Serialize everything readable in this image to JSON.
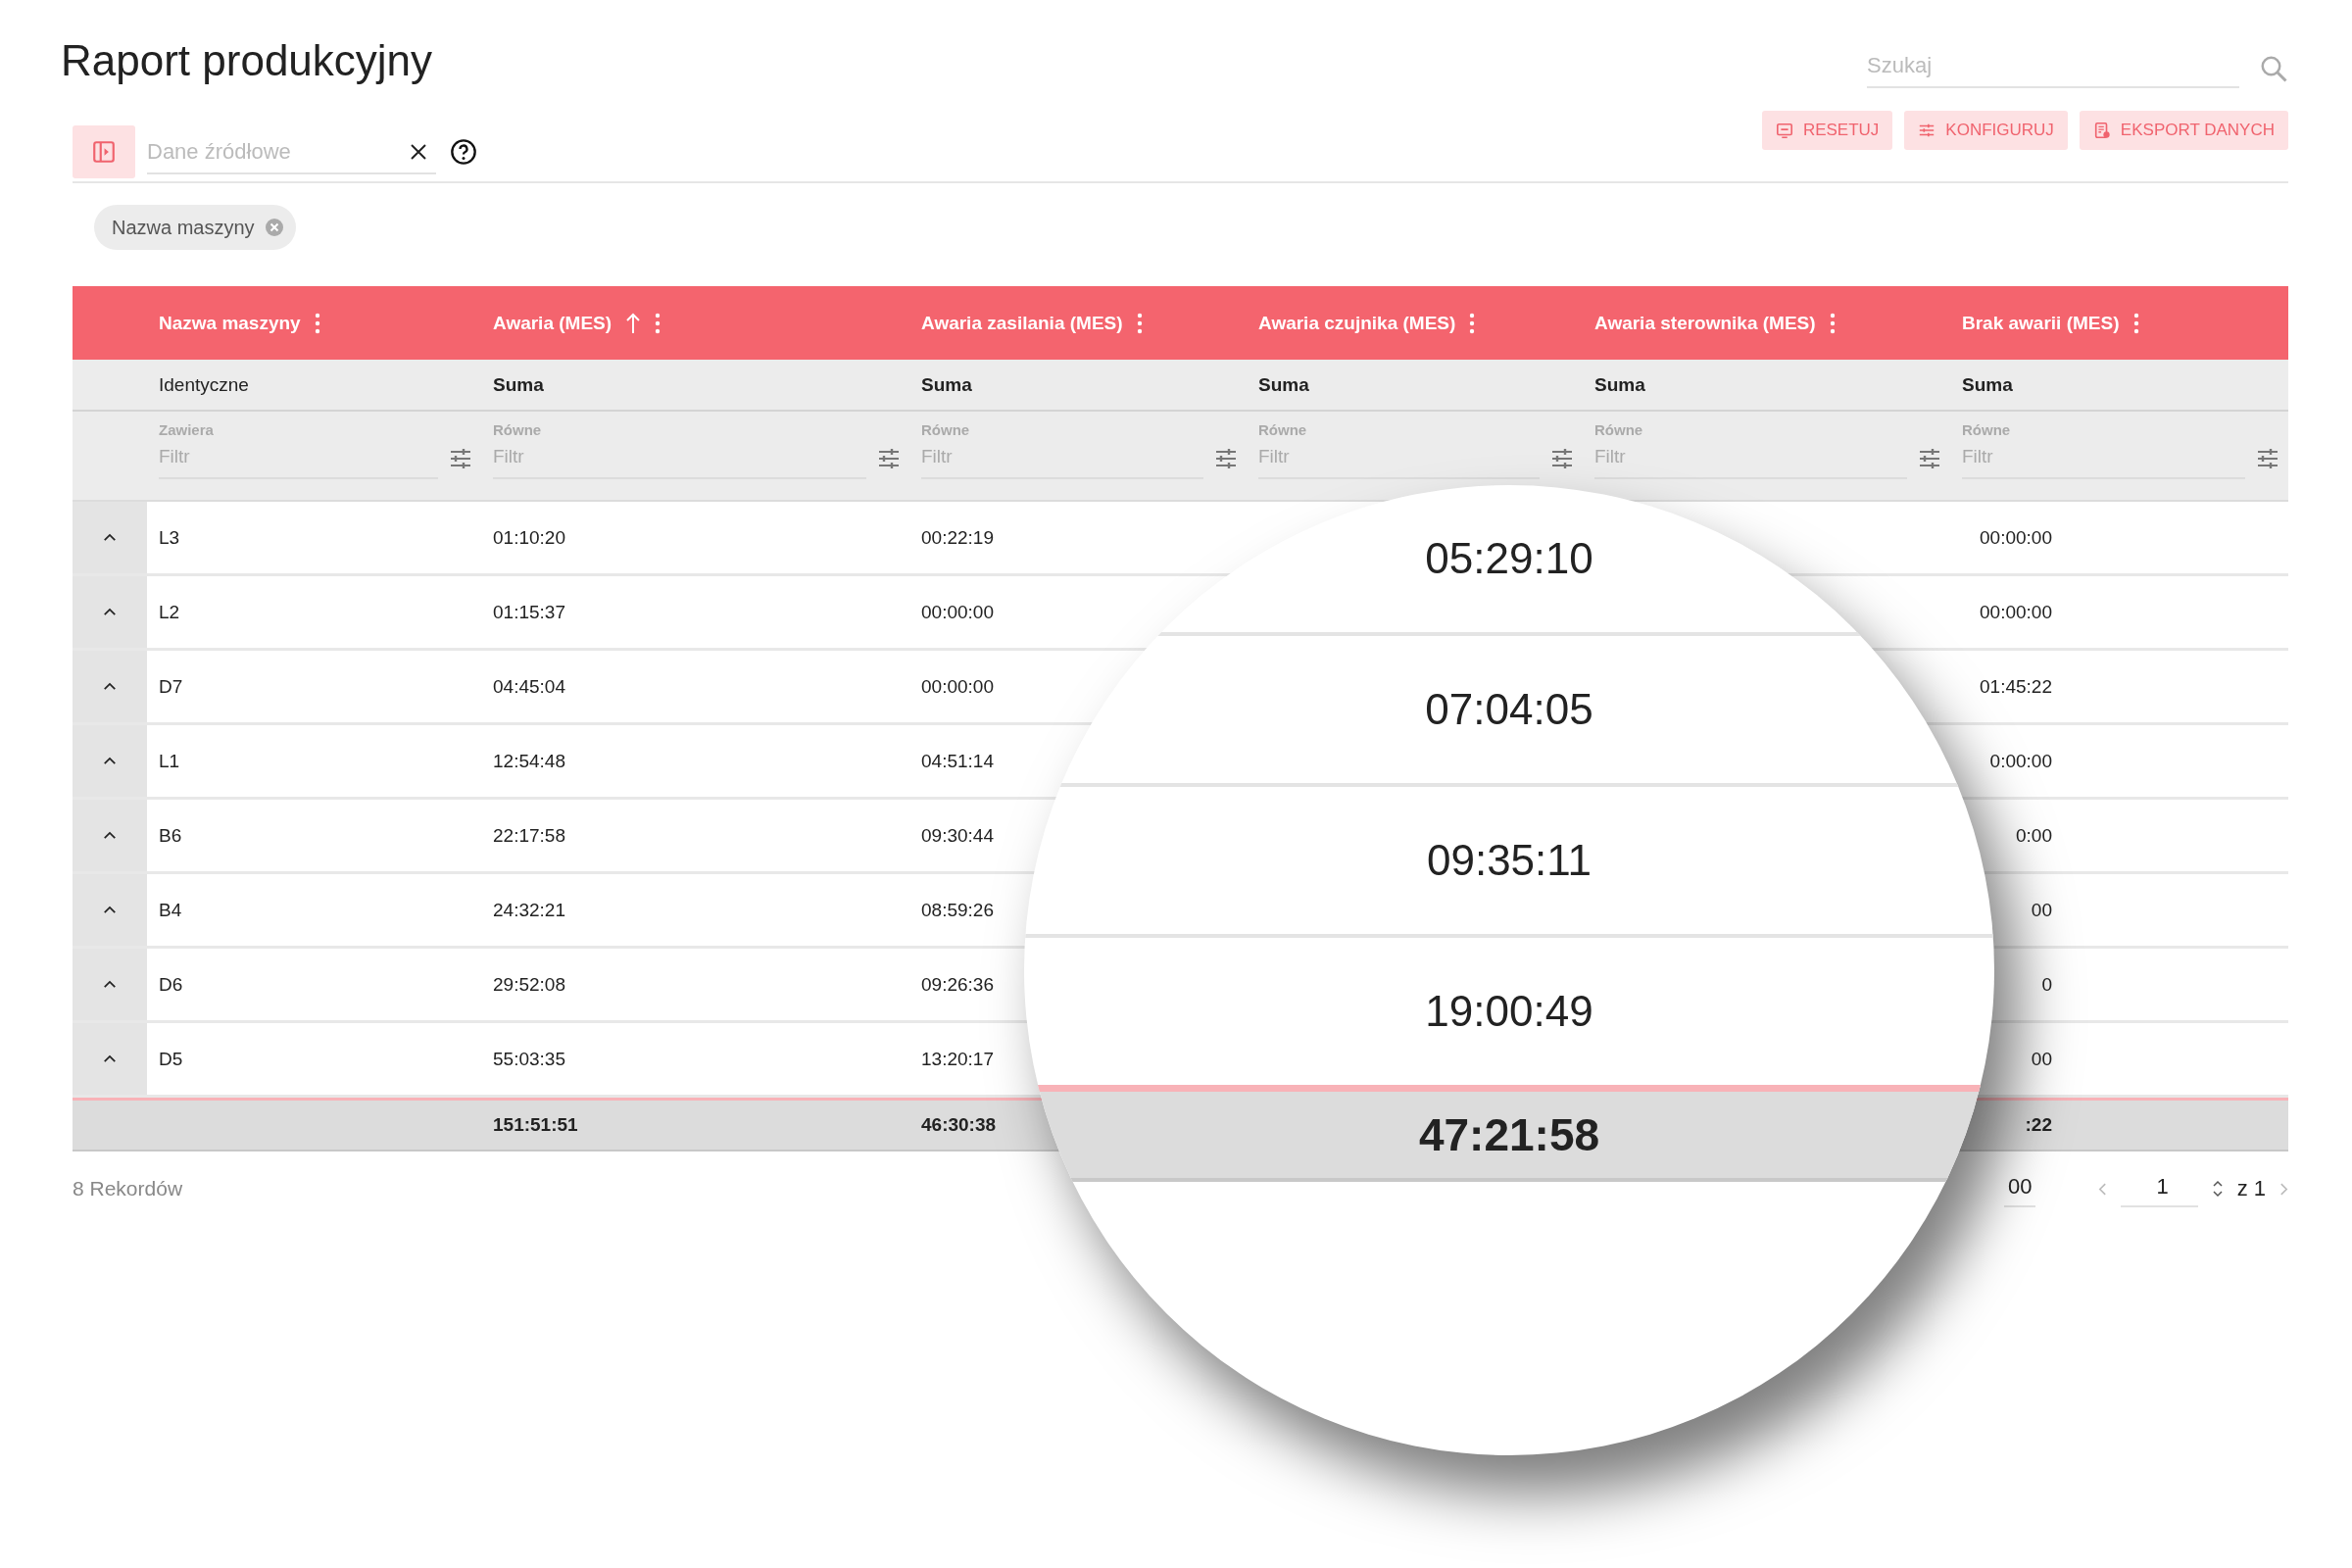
{
  "title": "Raport produkcyjny",
  "search": {
    "placeholder": "Szukaj"
  },
  "source_field": {
    "placeholder": "Dane źródłowe"
  },
  "toolbar_buttons": [
    {
      "kind": "reset",
      "label": "RESETUJ"
    },
    {
      "kind": "configure",
      "label": "KONFIGURUJ"
    },
    {
      "kind": "export",
      "label": "EKSPORT DANYCH"
    }
  ],
  "group_chips": [
    {
      "label": "Nazwa maszyny"
    }
  ],
  "table": {
    "columns": [
      {
        "kind": "text",
        "label": "Nazwa maszyny",
        "sorted": false,
        "aggregate": "Identyczne",
        "filter_label": "Zawiera",
        "filter_placeholder": "Filtr"
      },
      {
        "kind": "time",
        "label": "Awaria (MES)",
        "sorted": true,
        "aggregate": "Suma",
        "filter_label": "Równe",
        "filter_placeholder": "Filtr"
      },
      {
        "kind": "time",
        "label": "Awaria zasilania (MES)",
        "sorted": false,
        "aggregate": "Suma",
        "filter_label": "Równe",
        "filter_placeholder": "Filtr"
      },
      {
        "kind": "time",
        "label": "Awaria czujnika (MES)",
        "sorted": false,
        "aggregate": "Suma",
        "filter_label": "Równe",
        "filter_placeholder": "Filtr"
      },
      {
        "kind": "time",
        "label": "Awaria sterownika (MES)",
        "sorted": false,
        "aggregate": "Suma",
        "filter_label": "Równe",
        "filter_placeholder": "Filtr"
      },
      {
        "kind": "time",
        "label": "Brak awarii (MES)",
        "sorted": false,
        "aggregate": "Suma",
        "filter_label": "Równe",
        "filter_placeholder": "Filtr"
      }
    ],
    "rows": [
      {
        "name": "L3",
        "awaria": "01:10:20",
        "zasilania": "00:22:19",
        "brak": "00:00:00"
      },
      {
        "name": "L2",
        "awaria": "01:15:37",
        "zasilania": "00:00:00",
        "brak": "00:00:00"
      },
      {
        "name": "D7",
        "awaria": "04:45:04",
        "zasilania": "00:00:00",
        "brak": "01:45:22"
      },
      {
        "name": "L1",
        "awaria": "12:54:48",
        "zasilania": "04:51:14",
        "brak": "0:00:00"
      },
      {
        "name": "B6",
        "awaria": "22:17:58",
        "zasilania": "09:30:44",
        "brak": "0:00"
      },
      {
        "name": "B4",
        "awaria": "24:32:21",
        "zasilania": "08:59:26",
        "brak": "00"
      },
      {
        "name": "D6",
        "awaria": "29:52:08",
        "zasilania": "09:26:36",
        "brak": "0"
      },
      {
        "name": "D5",
        "awaria": "55:03:35",
        "zasilania": "13:20:17",
        "brak": "00"
      }
    ],
    "totals": {
      "awaria": "151:51:51",
      "zasilania": "46:30:38",
      "brak": ":22"
    }
  },
  "footer": {
    "records": "8 Rekordów",
    "page_size": "00",
    "page": "1",
    "page_total": "z 1"
  },
  "magnifier": {
    "rows": [
      "05:29:10",
      "07:04:05",
      "09:35:11",
      "19:00:49"
    ],
    "total": "47:21:58"
  }
}
